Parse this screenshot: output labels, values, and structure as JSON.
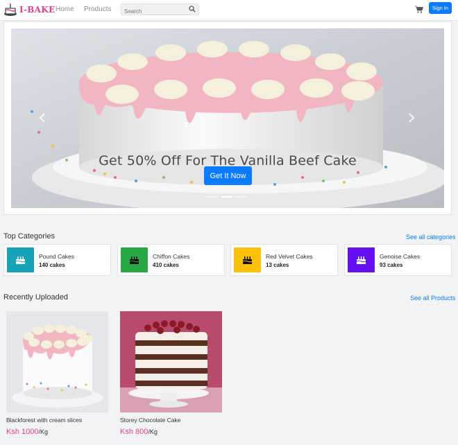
{
  "brand": {
    "name": "I-BAKE"
  },
  "nav": {
    "home": "Home",
    "products": "Products"
  },
  "search": {
    "placeholder": "Search"
  },
  "signin": "Sign In",
  "hero": {
    "caption": "Get 50% Off For The Vanilla Beef Cake",
    "button": "Get It Now",
    "slides": 3,
    "active_slide": 2
  },
  "categories": {
    "title": "Top Categories",
    "see_all": "See all categories",
    "items": [
      {
        "name": "Pound Cakes",
        "count": "140 cakes",
        "color": "#17a2b8",
        "icon": "cake-icon"
      },
      {
        "name": "Chiffon Cakes",
        "count": "410 cakes",
        "color": "#28a745",
        "icon": "cake-icon"
      },
      {
        "name": "Red Velvet Cakes",
        "count": "13 cakes",
        "color": "#ffc107",
        "icon": "cake-icon"
      },
      {
        "name": "Genoise Cakes",
        "count": "93 cakes",
        "color": "#6610f2",
        "icon": "cake-icon"
      }
    ]
  },
  "recent": {
    "title": "Recently Uploaded",
    "see_all": "See all Products",
    "items": [
      {
        "name": "Blackforest with cream slices",
        "price": "Ksh 1000",
        "unit": "/Kg"
      },
      {
        "name": "Storey Chocolate Cake",
        "price": "Ksh 800",
        "unit": "/Kg"
      }
    ]
  },
  "colors": {
    "accent": "#0b7bff",
    "brand": "#e83e8c"
  }
}
